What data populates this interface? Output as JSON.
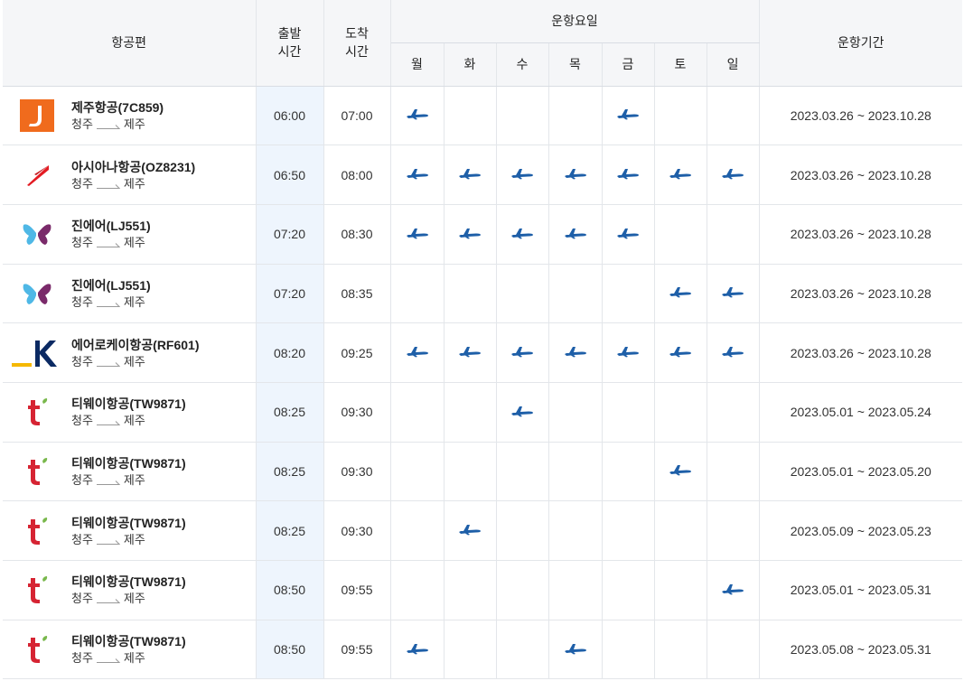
{
  "header": {
    "flight": "항공편",
    "dep": [
      "출발",
      "시간"
    ],
    "arr": [
      "도착",
      "시간"
    ],
    "days_title": "운항요일",
    "days": [
      "월",
      "화",
      "수",
      "목",
      "금",
      "토",
      "일"
    ],
    "period": "운항기간"
  },
  "route": {
    "from": "청주",
    "to": "제주"
  },
  "flights": [
    {
      "airline": "제주항공(7C859)",
      "logo": "jeju-air-logo",
      "dep": "06:00",
      "arr": "07:00",
      "days": [
        1,
        0,
        0,
        0,
        1,
        0,
        0
      ],
      "period": "2023.03.26 ~ 2023.10.28"
    },
    {
      "airline": "아시아나항공(OZ8231)",
      "logo": "asiana-logo",
      "dep": "06:50",
      "arr": "08:00",
      "days": [
        1,
        1,
        1,
        1,
        1,
        1,
        1
      ],
      "period": "2023.03.26 ~ 2023.10.28"
    },
    {
      "airline": "진에어(LJ551)",
      "logo": "jinair-logo",
      "dep": "07:20",
      "arr": "08:30",
      "days": [
        1,
        1,
        1,
        1,
        1,
        0,
        0
      ],
      "period": "2023.03.26 ~ 2023.10.28"
    },
    {
      "airline": "진에어(LJ551)",
      "logo": "jinair-logo",
      "dep": "07:20",
      "arr": "08:35",
      "days": [
        0,
        0,
        0,
        0,
        0,
        1,
        1
      ],
      "period": "2023.03.26 ~ 2023.10.28"
    },
    {
      "airline": "에어로케이항공(RF601)",
      "logo": "aerok-logo",
      "dep": "08:20",
      "arr": "09:25",
      "days": [
        1,
        1,
        1,
        1,
        1,
        1,
        1
      ],
      "period": "2023.03.26 ~ 2023.10.28"
    },
    {
      "airline": "티웨이항공(TW9871)",
      "logo": "tway-logo",
      "dep": "08:25",
      "arr": "09:30",
      "days": [
        0,
        0,
        1,
        0,
        0,
        0,
        0
      ],
      "period": "2023.05.01 ~ 2023.05.24"
    },
    {
      "airline": "티웨이항공(TW9871)",
      "logo": "tway-logo",
      "dep": "08:25",
      "arr": "09:30",
      "days": [
        0,
        0,
        0,
        0,
        0,
        1,
        0
      ],
      "period": "2023.05.01 ~ 2023.05.20"
    },
    {
      "airline": "티웨이항공(TW9871)",
      "logo": "tway-logo",
      "dep": "08:25",
      "arr": "09:30",
      "days": [
        0,
        1,
        0,
        0,
        0,
        0,
        0
      ],
      "period": "2023.05.09 ~ 2023.05.23"
    },
    {
      "airline": "티웨이항공(TW9871)",
      "logo": "tway-logo",
      "dep": "08:50",
      "arr": "09:55",
      "days": [
        0,
        0,
        0,
        0,
        0,
        0,
        1
      ],
      "period": "2023.05.01 ~ 2023.05.31"
    },
    {
      "airline": "티웨이항공(TW9871)",
      "logo": "tway-logo",
      "dep": "08:50",
      "arr": "09:55",
      "days": [
        1,
        0,
        0,
        1,
        0,
        0,
        0
      ],
      "period": "2023.05.08 ~ 2023.05.31"
    }
  ],
  "icons": {
    "operating_day": "airplane-icon",
    "route_arrow": "arrow-right-icon"
  },
  "colors": {
    "plane": "#1e5fa8",
    "header_bg": "#f5f6f8",
    "dep_col_bg": "#eef5fd"
  }
}
